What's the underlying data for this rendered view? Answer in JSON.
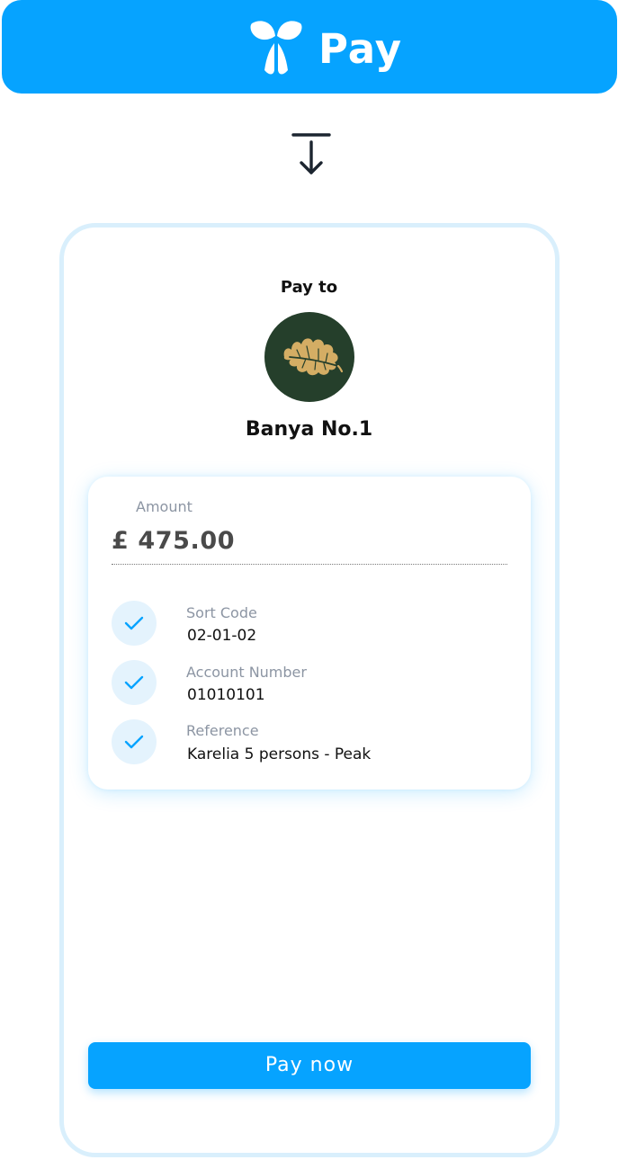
{
  "header": {
    "brand_name": "Pay",
    "logo_icon": "split-y-logo-icon",
    "brand_color": "#06a3ff"
  },
  "arrow": {
    "icon": "arrow-down-to-line-icon"
  },
  "merchant": {
    "pay_to_label": "Pay to",
    "name": "Banya No.1",
    "avatar_icon": "oak-leaf-icon",
    "avatar_color": "#253f2b",
    "leaf_color": "#d4ad64"
  },
  "payment": {
    "amount_label": "Amount",
    "amount_value": "£ 475.00",
    "details": [
      {
        "label": "Sort Code",
        "value": "02-01-02",
        "status_icon": "checkmark-icon"
      },
      {
        "label": "Account Number",
        "value": "01010101",
        "status_icon": "checkmark-icon"
      },
      {
        "label": "Reference",
        "value": "Karelia 5 persons - Peak",
        "status_icon": "checkmark-icon"
      }
    ]
  },
  "actions": {
    "pay_now_label": "Pay now"
  }
}
